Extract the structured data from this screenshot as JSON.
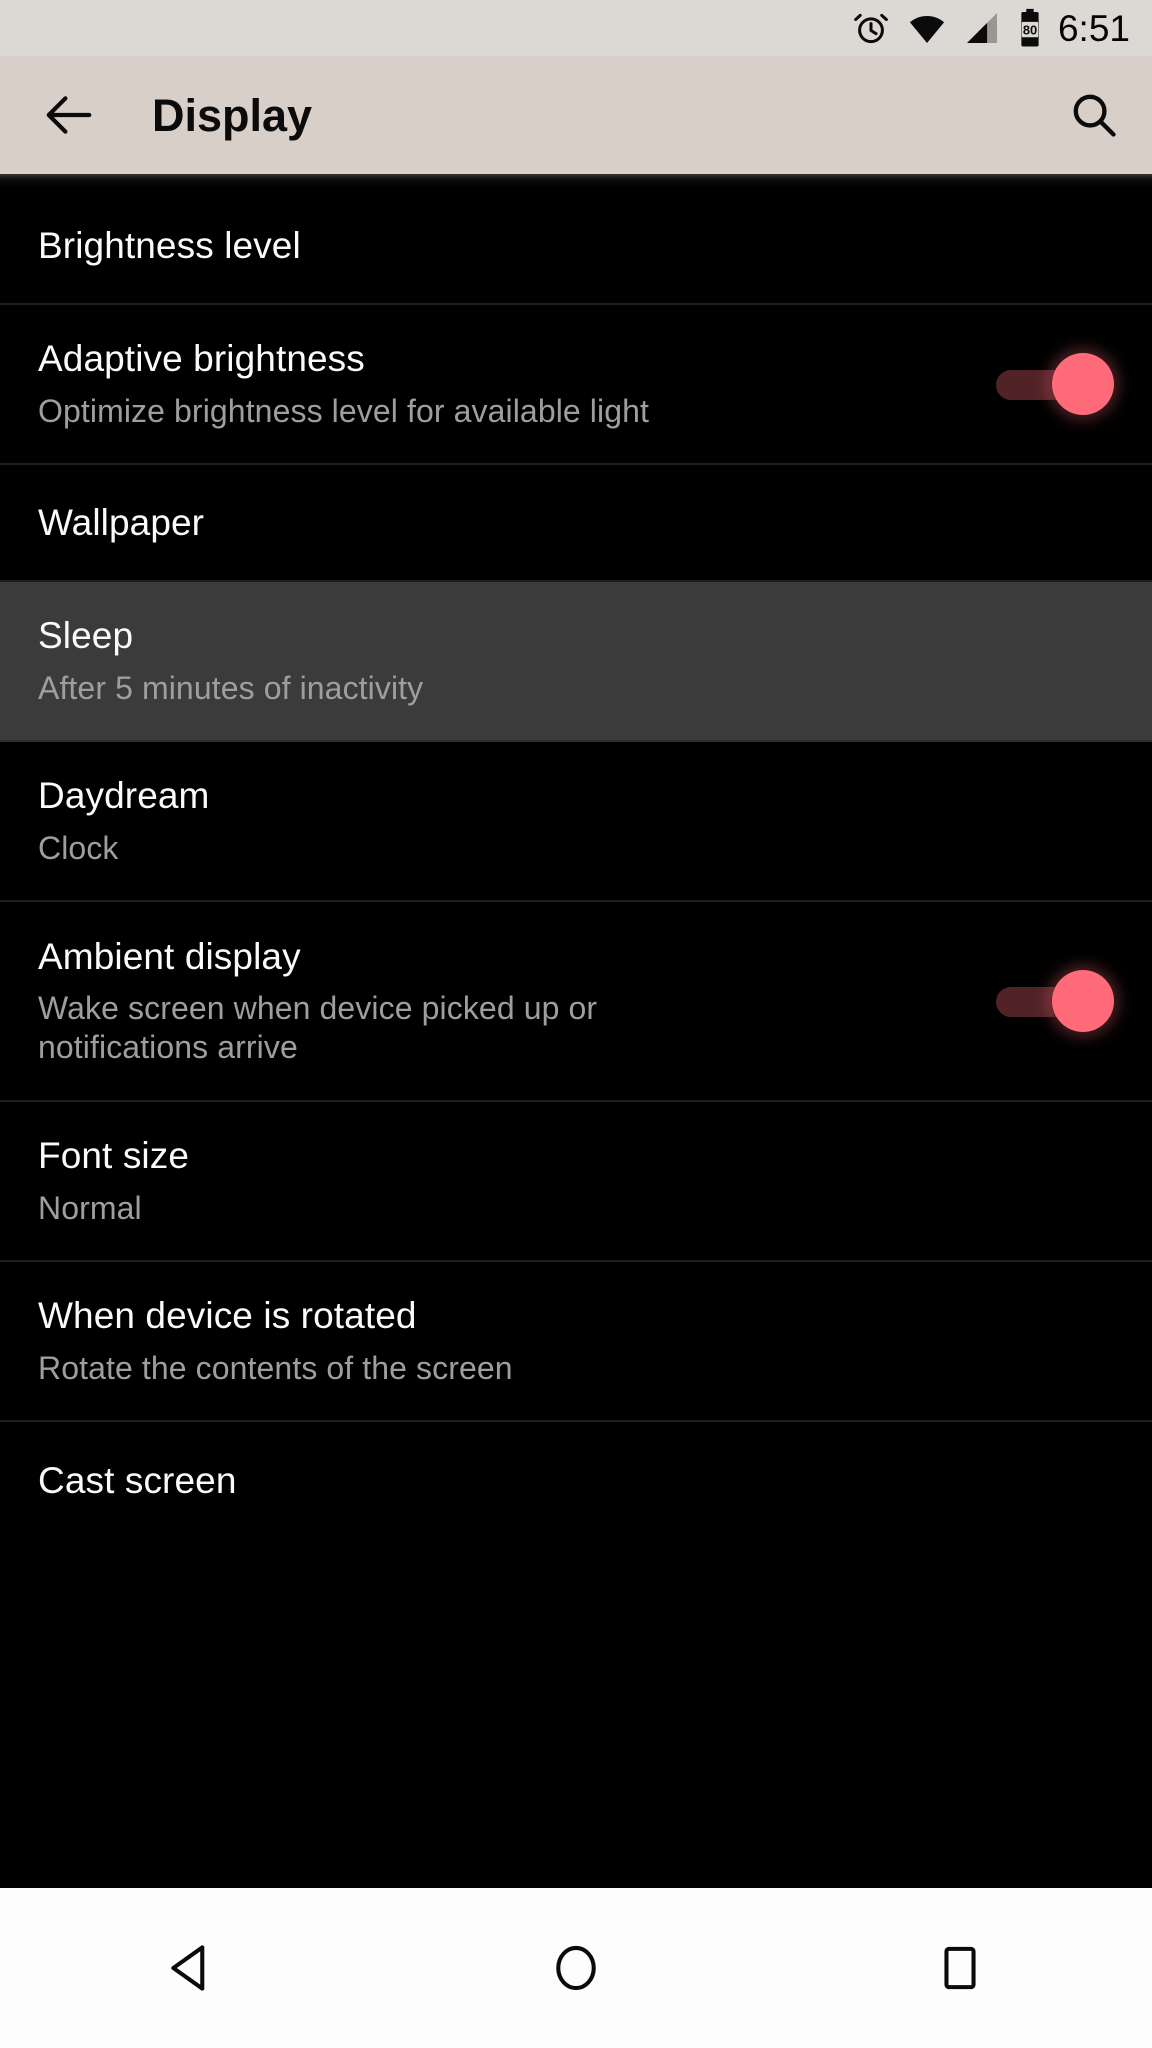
{
  "status_bar": {
    "time": "6:51",
    "battery_level": "80",
    "icons": [
      "alarm-icon",
      "wifi-icon",
      "cellular-signal-icon",
      "battery-icon"
    ],
    "background_color": "#dcd8d3",
    "text_color": "#050505"
  },
  "toolbar": {
    "title": "Display",
    "back_icon": "back-arrow-icon",
    "search_icon": "search-icon",
    "background_color": "#d9cfc9",
    "title_color": "#0b0b0b"
  },
  "theme": {
    "list_background": "#000000",
    "row_highlight": "#3b3b3b",
    "divider": "#1f1f1f",
    "title_color": "#fafafa",
    "summary_color": "#9e9e9e",
    "switch_on_thumb": "#ff6b78",
    "switch_on_track": "#512327",
    "nav_background": "#fdfdfd",
    "nav_icon_color": "#0a0a0a"
  },
  "settings": [
    {
      "title": "Brightness level",
      "summary": "",
      "has_switch": false,
      "switch_on": false,
      "highlighted": false
    },
    {
      "title": "Adaptive brightness",
      "summary": "Optimize brightness level for available light",
      "has_switch": true,
      "switch_on": true,
      "highlighted": false
    },
    {
      "title": "Wallpaper",
      "summary": "",
      "has_switch": false,
      "switch_on": false,
      "highlighted": false
    },
    {
      "title": "Sleep",
      "summary": "After 5 minutes of inactivity",
      "has_switch": false,
      "switch_on": false,
      "highlighted": true
    },
    {
      "title": "Daydream",
      "summary": "Clock",
      "has_switch": false,
      "switch_on": false,
      "highlighted": false
    },
    {
      "title": "Ambient display",
      "summary": "Wake screen when device picked up or notifications arrive",
      "has_switch": true,
      "switch_on": true,
      "highlighted": false
    },
    {
      "title": "Font size",
      "summary": "Normal",
      "has_switch": false,
      "switch_on": false,
      "highlighted": false
    },
    {
      "title": "When device is rotated",
      "summary": "Rotate the contents of the screen",
      "has_switch": false,
      "switch_on": false,
      "highlighted": false
    },
    {
      "title": "Cast screen",
      "summary": "",
      "has_switch": false,
      "switch_on": false,
      "highlighted": false
    }
  ],
  "nav_bar": {
    "back_label": "Back",
    "home_label": "Home",
    "recents_label": "Recent apps",
    "icons": [
      "nav-back-icon",
      "nav-home-icon",
      "nav-recents-icon"
    ]
  }
}
